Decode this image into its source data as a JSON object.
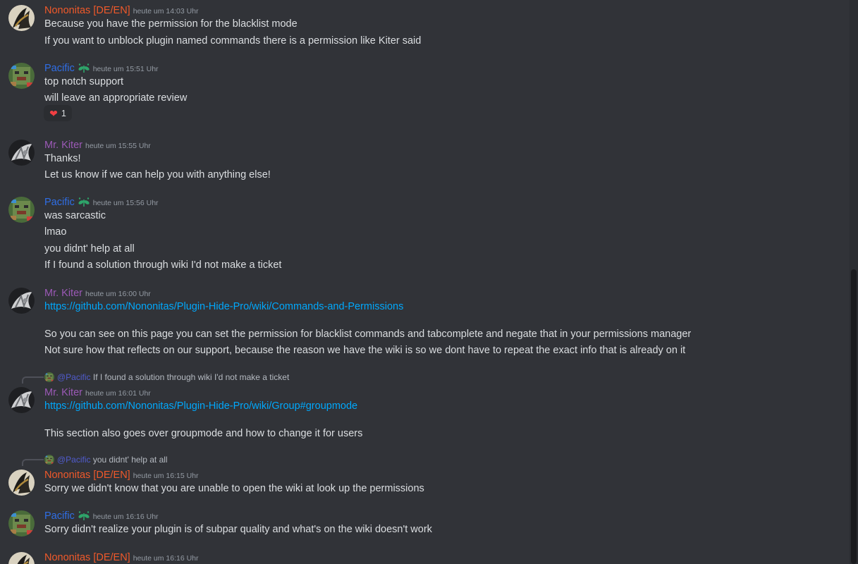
{
  "users": {
    "nononitas": {
      "name": "Nononitas [DE/EN]",
      "color": "#f0592a"
    },
    "pacific": {
      "name": "Pacific",
      "color": "#2f6ee6"
    },
    "kiter": {
      "name": "Mr. Kiter",
      "color": "#9b59b6"
    }
  },
  "messages": [
    {
      "ts": "heute um 14:03 Uhr",
      "lines": [
        "Because you have the permission for the blacklist mode",
        "If you want to unblock plugin named commands there is a permission like Kiter said"
      ]
    },
    {
      "ts": "heute um 15:51 Uhr",
      "lines": [
        "top notch support",
        "will leave an appropriate review"
      ],
      "reaction": {
        "emoji": "❤",
        "count": "1"
      }
    },
    {
      "ts": "heute um 15:55 Uhr",
      "lines": [
        "Thanks!",
        "Let us know if we can help you with anything else!"
      ]
    },
    {
      "ts": "heute um 15:56 Uhr",
      "lines": [
        "was sarcastic",
        "lmao",
        "you didnt' help at all",
        "If I found a solution through wiki I'd not make a ticket"
      ]
    },
    {
      "ts": "heute um 16:00 Uhr",
      "link": "https://github.com/Nononitas/Plugin-Hide-Pro/wiki/Commands-and-Permissions",
      "lines": [
        "So you can see on this page you can set the permission for blacklist commands and tabcomplete and negate that in your permissions manager",
        "Not sure how that reflects on our support, because the reason we have the wiki is so we dont have to repeat the exact info that is already on it"
      ]
    },
    {
      "ts": "heute um 16:01 Uhr",
      "reply": {
        "mention": "@Pacific",
        "text": "If I found a solution through wiki I'd not make a ticket"
      },
      "link": "https://github.com/Nononitas/Plugin-Hide-Pro/wiki/Group#groupmode",
      "lines": [
        "This section also goes over groupmode and how to change it for users"
      ]
    },
    {
      "ts": "heute um 16:15 Uhr",
      "reply": {
        "mention": "@Pacific",
        "text": "you didnt' help at all"
      },
      "lines": [
        "Sorry we didn't know that you are unable to open the wiki at look up the permissions"
      ]
    },
    {
      "ts": "heute um 16:16 Uhr",
      "lines": [
        "Sorry didn't realize your plugin is of subpar quality and what's on the wiki doesn't work"
      ]
    },
    {
      "ts": "heute um 16:16 Uhr",
      "lines": []
    }
  ],
  "icons": {
    "badge": "leaf-badge-icon",
    "reaction": "heart-icon"
  }
}
